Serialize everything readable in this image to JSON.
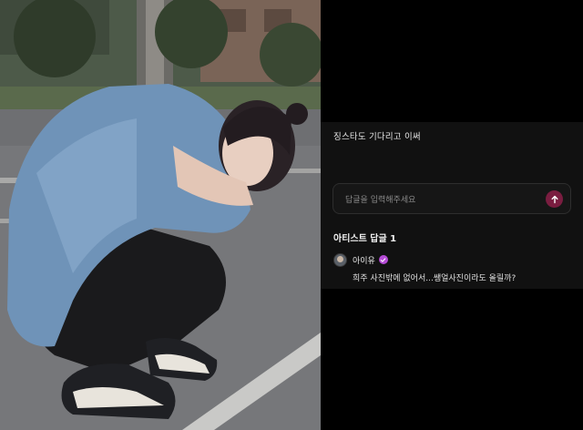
{
  "comment": {
    "text": "징스타도 기다리고 이써"
  },
  "reply_input": {
    "placeholder": "답글을 입력해주세요",
    "send_icon": "arrow-up-icon",
    "send_color": "#7a1d40"
  },
  "artist_replies": {
    "title": "아티스트 답글 1",
    "items": [
      {
        "name": "아이유",
        "verified": true,
        "badge_color": "#b54bd6",
        "text": "희주 사진밖에 없어서...쌩얼사진이라도 올릴까?"
      }
    ]
  },
  "photo": {
    "description_icon": "photo-image"
  }
}
